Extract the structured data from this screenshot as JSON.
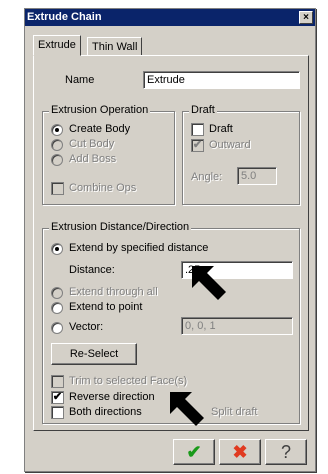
{
  "window": {
    "title": "Extrude Chain",
    "close_label": "×"
  },
  "tabs": [
    {
      "label": "Extrude"
    },
    {
      "label": "Thin Wall"
    }
  ],
  "name": {
    "label": "Name",
    "value": "Extrude"
  },
  "extrusion_operation": {
    "title": "Extrusion Operation",
    "options": [
      {
        "label": "Create Body",
        "selected": true,
        "enabled": true
      },
      {
        "label": "Cut Body",
        "selected": false,
        "enabled": false
      },
      {
        "label": "Add Boss",
        "selected": false,
        "enabled": false
      }
    ],
    "combine_label": "Combine Ops"
  },
  "draft": {
    "title": "Draft",
    "draft_label": "Draft",
    "outward_label": "Outward",
    "angle_label": "Angle:",
    "angle_value": "5.0"
  },
  "distance_direction": {
    "title": "Extrusion Distance/Direction",
    "extend_specified_label": "Extend by specified distance",
    "distance_label": "Distance:",
    "distance_value": ".25",
    "extend_through_label": "Extend through all",
    "extend_point_label": "Extend to point",
    "vector_label": "Vector:",
    "vector_value": "0, 0, 1",
    "reselect_label": "Re-Select",
    "trim_label": "Trim to selected Face(s)",
    "reverse_label": "Reverse direction",
    "both_label": "Both directions",
    "split_label": "Split draft"
  },
  "buttons": {
    "ok": "✔",
    "cancel": "✖",
    "help": "?"
  }
}
